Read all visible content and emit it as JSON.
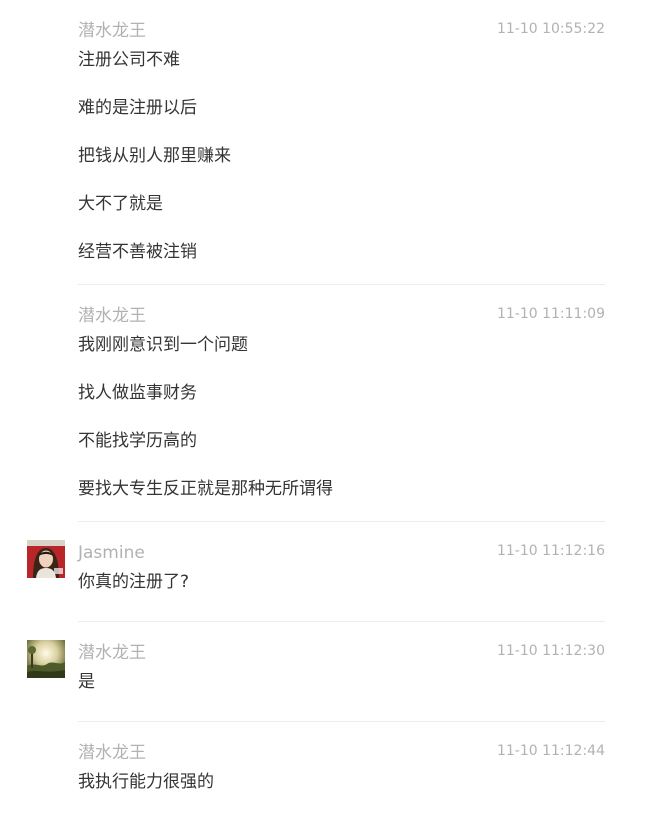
{
  "messages": [
    {
      "sender": "潜水龙王",
      "time": "11-10 10:55:22",
      "avatar": null,
      "lines": [
        "注册公司不难",
        "难的是注册以后",
        "把钱从别人那里赚来",
        "大不了就是",
        "经营不善被注销"
      ]
    },
    {
      "sender": "潜水龙王",
      "time": "11-10 11:11:09",
      "avatar": null,
      "lines": [
        "我刚刚意识到一个问题",
        "找人做监事财务",
        "不能找学历高的",
        "要找大专生反正就是那种无所谓得"
      ]
    },
    {
      "sender": "Jasmine",
      "time": "11-10 11:12:16",
      "avatar": "woman-portrait-avatar",
      "lines": [
        "你真的注册了?"
      ]
    },
    {
      "sender": "潜水龙王",
      "time": "11-10 11:12:30",
      "avatar": "landscape-avatar",
      "lines": [
        "是"
      ]
    },
    {
      "sender": "潜水龙王",
      "time": "11-10 11:12:44",
      "avatar": null,
      "lines": [
        "我执行能力很强的"
      ]
    }
  ]
}
